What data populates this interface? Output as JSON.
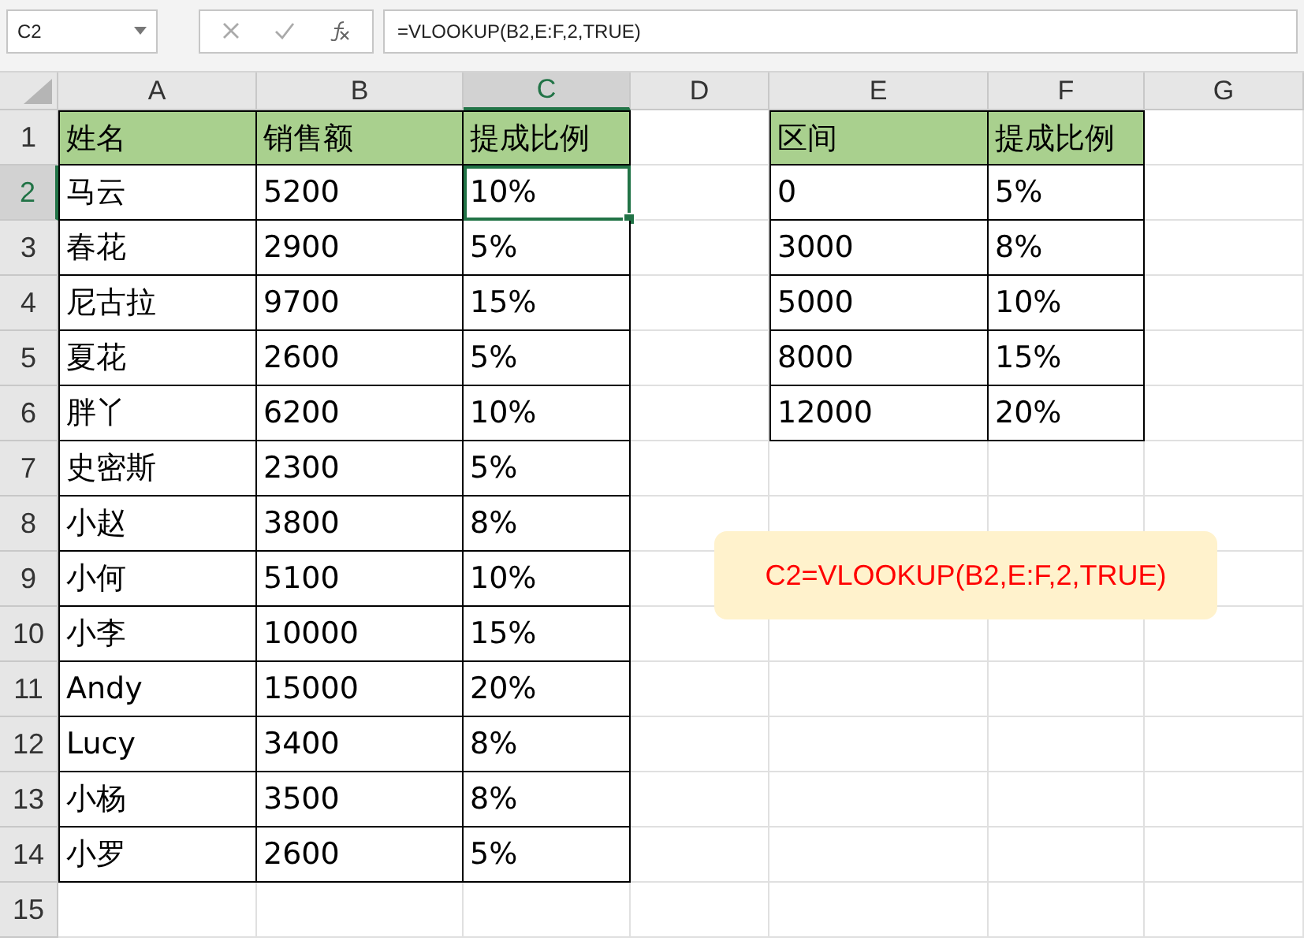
{
  "formula_bar": {
    "name_box": "C2",
    "formula": "=VLOOKUP(B2,E:F,2,TRUE)"
  },
  "columns": [
    {
      "label": "A",
      "selected": false
    },
    {
      "label": "B",
      "selected": false
    },
    {
      "label": "C",
      "selected": true
    },
    {
      "label": "D",
      "selected": false
    },
    {
      "label": "E",
      "selected": false
    },
    {
      "label": "F",
      "selected": false
    },
    {
      "label": "G",
      "selected": false
    }
  ],
  "rows": [
    {
      "number": "1",
      "selected": false,
      "kind": "header",
      "main": [
        {
          "text": "姓名",
          "selected": false
        },
        {
          "text": "销售额",
          "selected": false
        },
        {
          "text": "提成比例",
          "selected": false
        }
      ],
      "lookup": [
        "区间",
        "提成比例"
      ]
    },
    {
      "number": "2",
      "selected": true,
      "kind": "data",
      "main": [
        {
          "text": "马云",
          "selected": false
        },
        {
          "text": "5200",
          "selected": false
        },
        {
          "text": "10%",
          "selected": true
        }
      ],
      "lookup": [
        "0",
        "5%"
      ]
    },
    {
      "number": "3",
      "selected": false,
      "kind": "data",
      "main": [
        {
          "text": "春花",
          "selected": false
        },
        {
          "text": "2900",
          "selected": false
        },
        {
          "text": "5%",
          "selected": false
        }
      ],
      "lookup": [
        "3000",
        "8%"
      ]
    },
    {
      "number": "4",
      "selected": false,
      "kind": "data",
      "main": [
        {
          "text": "尼古拉",
          "selected": false
        },
        {
          "text": "9700",
          "selected": false
        },
        {
          "text": "15%",
          "selected": false
        }
      ],
      "lookup": [
        "5000",
        "10%"
      ]
    },
    {
      "number": "5",
      "selected": false,
      "kind": "data",
      "main": [
        {
          "text": "夏花",
          "selected": false
        },
        {
          "text": "2600",
          "selected": false
        },
        {
          "text": "5%",
          "selected": false
        }
      ],
      "lookup": [
        "8000",
        "15%"
      ]
    },
    {
      "number": "6",
      "selected": false,
      "kind": "data",
      "main": [
        {
          "text": "胖丫",
          "selected": false
        },
        {
          "text": "6200",
          "selected": false
        },
        {
          "text": "10%",
          "selected": false
        }
      ],
      "lookup": [
        "12000",
        "20%"
      ]
    },
    {
      "number": "7",
      "selected": false,
      "kind": "data",
      "main": [
        {
          "text": "史密斯",
          "selected": false
        },
        {
          "text": "2300",
          "selected": false
        },
        {
          "text": "5%",
          "selected": false
        }
      ]
    },
    {
      "number": "8",
      "selected": false,
      "kind": "data",
      "main": [
        {
          "text": "小赵",
          "selected": false
        },
        {
          "text": "3800",
          "selected": false
        },
        {
          "text": "8%",
          "selected": false
        }
      ]
    },
    {
      "number": "9",
      "selected": false,
      "kind": "data",
      "main": [
        {
          "text": "小何",
          "selected": false
        },
        {
          "text": "5100",
          "selected": false
        },
        {
          "text": "10%",
          "selected": false
        }
      ]
    },
    {
      "number": "10",
      "selected": false,
      "kind": "data",
      "main": [
        {
          "text": "小李",
          "selected": false
        },
        {
          "text": "10000",
          "selected": false
        },
        {
          "text": "15%",
          "selected": false
        }
      ]
    },
    {
      "number": "11",
      "selected": false,
      "kind": "data",
      "main": [
        {
          "text": "Andy",
          "selected": false
        },
        {
          "text": "15000",
          "selected": false
        },
        {
          "text": "20%",
          "selected": false
        }
      ]
    },
    {
      "number": "12",
      "selected": false,
      "kind": "data",
      "main": [
        {
          "text": "Lucy",
          "selected": false
        },
        {
          "text": "3400",
          "selected": false
        },
        {
          "text": "8%",
          "selected": false
        }
      ]
    },
    {
      "number": "13",
      "selected": false,
      "kind": "data",
      "main": [
        {
          "text": "小杨",
          "selected": false
        },
        {
          "text": "3500",
          "selected": false
        },
        {
          "text": "8%",
          "selected": false
        }
      ]
    },
    {
      "number": "14",
      "selected": false,
      "kind": "data",
      "main": [
        {
          "text": "小罗",
          "selected": false
        },
        {
          "text": "2600",
          "selected": false
        },
        {
          "text": "5%",
          "selected": false
        }
      ]
    },
    {
      "number": "15",
      "selected": false,
      "kind": "empty"
    }
  ],
  "callout": "C2=VLOOKUP(B2,E:F,2,TRUE)"
}
